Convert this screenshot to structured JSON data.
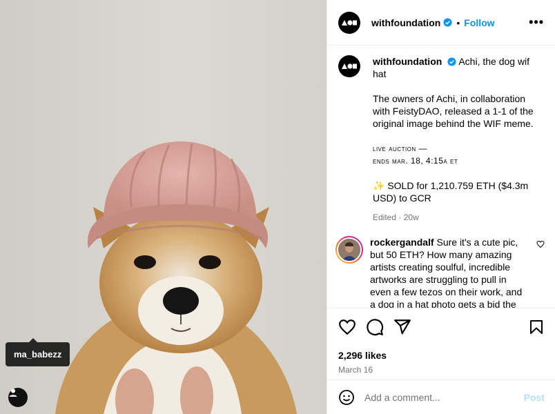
{
  "post": {
    "username": "withfoundation",
    "follow_label": "Follow",
    "separator": "•",
    "more_label": "•••",
    "tagged_user": "ma_babezz",
    "caption": {
      "title": "Achi, the dog wif hat",
      "body": "The owners of Achi, in collaboration with FeistyDAO, released a 1-1 of the original image behind the WIF meme.",
      "auction_line1": "live auction —",
      "auction_line2": "ends mar. 18, 4:15a et",
      "sold": "✨ SOLD for 1,210.759 ETH ($4.3m USD) to GCR",
      "edited": "Edited",
      "meta_separator": "·",
      "age": "20w"
    },
    "comment": {
      "username": "rockergandalf",
      "text": "Sure it's a cute pic, but 50 ETH? How many amazing artists creating soulful, incredible artworks are struggling to pull in even a few tezos on their work, and a dog in a hat photo gets a bid the"
    },
    "likes": "2,296 likes",
    "date": "March 16",
    "add_comment_placeholder": "Add a comment...",
    "post_label": "Post"
  },
  "colors": {
    "accent": "#0095f6",
    "post_disabled": "#b2dffc",
    "muted": "#737373",
    "verified": "#0095f6"
  },
  "icons": [
    "verified-badge-icon",
    "more-options-icon",
    "like-heart-icon",
    "comment-icon",
    "share-icon",
    "save-bookmark-icon",
    "emoji-icon",
    "user-tag-icon",
    "comment-like-heart-icon"
  ]
}
